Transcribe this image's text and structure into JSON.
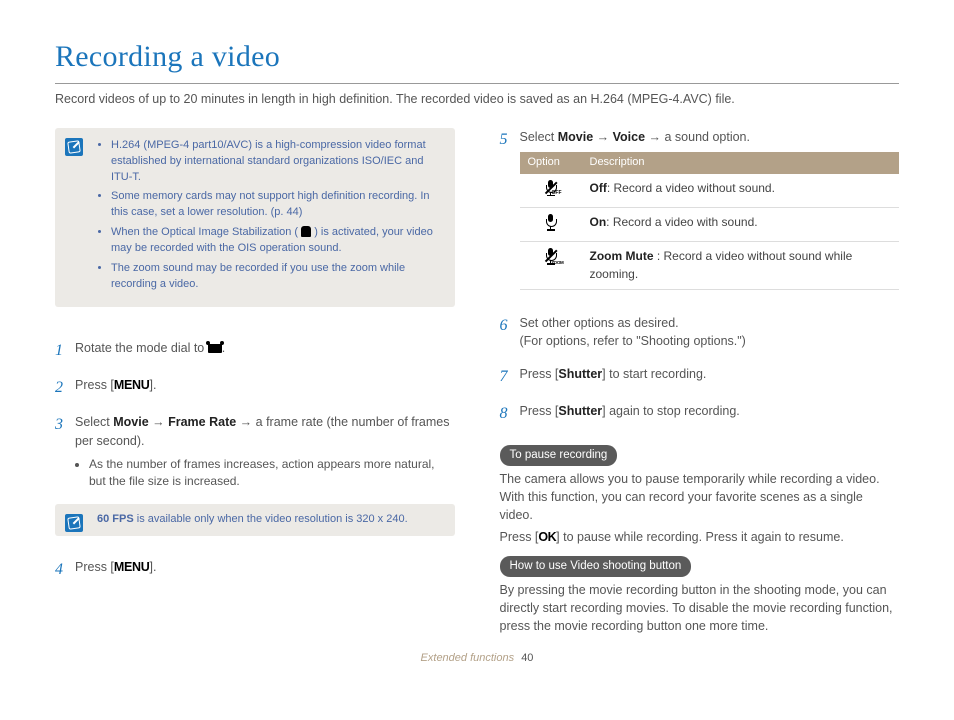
{
  "title": "Recording a video",
  "intro": "Record videos of up to 20 minutes in length in high definition. The recorded video is saved as an H.264 (MPEG-4.AVC) file.",
  "info_notes": [
    "H.264 (MPEG-4 part10/AVC) is a high-compression video format established by international standard organizations ISO/IEC and ITU-T.",
    "Some memory cards may not support high definition recording. In this case, set a lower resolution. (p. 44)",
    "When the Optical Image Stabilization ( ",
    " ) is activated, your video may be recorded with the OIS operation sound.",
    "The zoom sound may be recorded if you use the zoom while recording a video."
  ],
  "steps_left": {
    "s1_a": "Rotate the mode dial to ",
    "s1_b": ".",
    "s2_a": "Press [",
    "s2_menu": "MENU",
    "s2_b": "].",
    "s3_a": "Select ",
    "s3_movie": "Movie",
    "s3_arrow1": " → ",
    "s3_fr": "Frame Rate",
    "s3_arrow2": " → ",
    "s3_b": "a frame rate (the number of frames per second).",
    "s3_note": "As the number of frames increases, action appears more natural, but the file size is increased.",
    "fps_note_a": "60 FPS",
    "fps_note_b": " is available only when the video resolution is 320 x 240.",
    "s4_a": "Press [",
    "s4_menu": "MENU",
    "s4_b": "]."
  },
  "steps_right": {
    "s5_a": "Select ",
    "s5_movie": "Movie",
    "s5_arrow1": " → ",
    "s5_voice": "Voice",
    "s5_arrow2": " → ",
    "s5_b": "a sound option.",
    "s6": "Set other options as desired.",
    "s6_sub": "(For options, refer to \"Shooting options.\")",
    "s7_a": "Press [",
    "s7_sh": "Shutter",
    "s7_b": "] to start recording.",
    "s8_a": "Press [",
    "s8_sh": "Shutter",
    "s8_b": "] again to stop recording."
  },
  "voice_table": {
    "headers": {
      "opt": "Option",
      "desc": "Description"
    },
    "rows": [
      {
        "label": "Off",
        "desc": ": Record a video without sound."
      },
      {
        "label": "On",
        "desc": ": Record a video with sound."
      },
      {
        "label": "Zoom Mute",
        "desc": " : Record a video without sound while zooming."
      }
    ]
  },
  "pause": {
    "title": "To pause recording",
    "p1": "The camera allows you to pause temporarily while recording a video. With this function, you can record your favorite scenes as a single video.",
    "p2_a": "Press [",
    "p2_ok": "OK",
    "p2_b": "] to pause while recording. Press it again to resume."
  },
  "howto": {
    "title": "How to use Video shooting button",
    "p": "By pressing the movie recording button in the shooting mode, you can directly start recording movies. To disable the movie recording function, press the movie recording button one more time."
  },
  "footer": {
    "section": "Extended functions",
    "page": "40"
  }
}
